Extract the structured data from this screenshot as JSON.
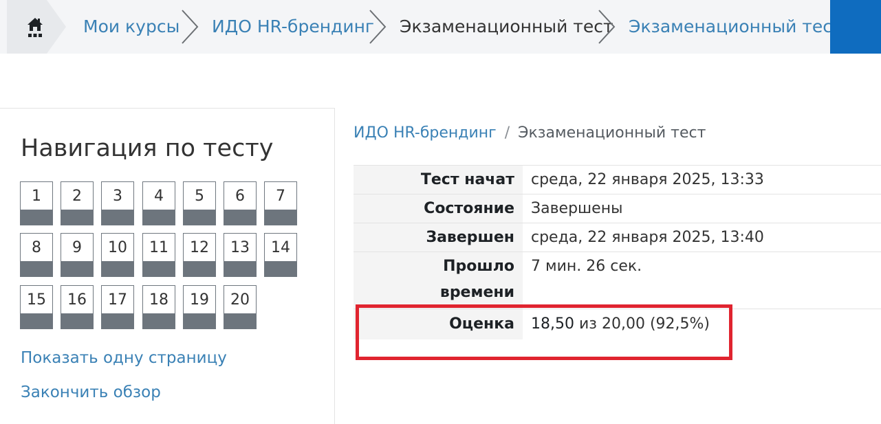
{
  "breadcrumb": {
    "home_icon": "home-icon",
    "items": [
      {
        "label": "Мои курсы",
        "link": true
      },
      {
        "label": "ИДО HR-брендинг",
        "link": true
      },
      {
        "label": "Экзаменационный тест",
        "link": false
      },
      {
        "label": "Экзаменационный тест",
        "link": true
      }
    ]
  },
  "quiz_nav": {
    "title": "Навигация по тесту",
    "questions": [
      "1",
      "2",
      "3",
      "4",
      "5",
      "6",
      "7",
      "8",
      "9",
      "10",
      "11",
      "12",
      "13",
      "14",
      "15",
      "16",
      "17",
      "18",
      "19",
      "20"
    ],
    "show_one_page": "Показать одну страницу",
    "finish_review": "Закончить обзор"
  },
  "page_breadcrumb": {
    "course": "ИДО HR-брендинг",
    "separator": "/",
    "current": "Экзаменационный тест"
  },
  "summary": {
    "started_label": "Тест начат",
    "started_value": "среда, 22 января 2025, 13:33",
    "state_label": "Состояние",
    "state_value": "Завершены",
    "completed_label": "Завершен",
    "completed_value": "среда, 22 января 2025, 13:40",
    "time_taken_label_1": "Прошло",
    "time_taken_label_2": "времени",
    "time_taken_value": "7 мин. 26 сек.",
    "grade_label": "Оценка",
    "grade_score": "18,50",
    "grade_rest": "из 20,00 (92,5%)"
  },
  "colors": {
    "link": "#3a81b5",
    "accent_block": "#0f6cbf",
    "highlight": "#e0242f",
    "question_status": "#6d757d"
  }
}
